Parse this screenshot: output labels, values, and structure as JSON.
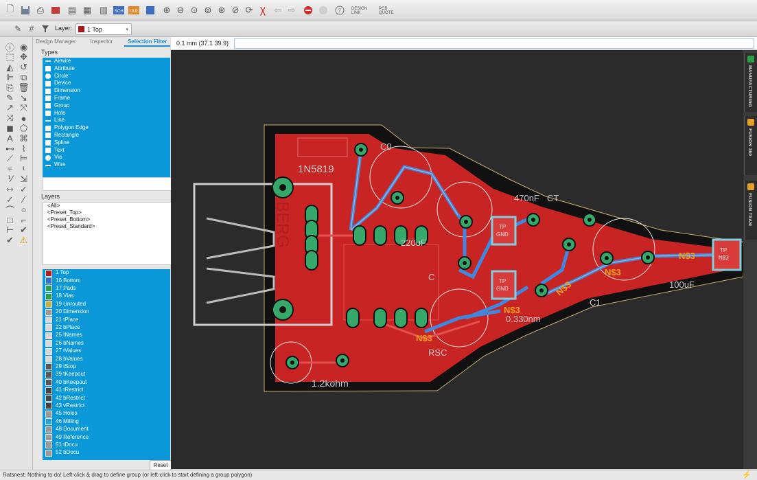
{
  "toolbar": {
    "icons": [
      "new-file-icon",
      "save-icon",
      "print-icon",
      "cam-icon",
      "script-icon",
      "run-icon",
      "board-icon",
      "sch-icon",
      "ulp-icon",
      "zoom-fit-icon",
      "zoom-in-icon",
      "zoom-out-icon",
      "zoom-select-icon",
      "zoom-area-icon",
      "redraw-icon",
      "undo-icon",
      "redo-icon",
      "stop-icon",
      "go-icon",
      "help-icon"
    ],
    "sch_label": "SCH",
    "ulp_label": "ULP",
    "design_link_label": "DESIGN LINK",
    "pcb_quote_label": "PCB QUOTE"
  },
  "layerbar": {
    "label": "Layer:",
    "selected": "1 Top",
    "selected_color": "#a31818"
  },
  "panel": {
    "tabs": [
      "Design Manager",
      "Inspector",
      "Selection Filter"
    ],
    "active_tab": "Selection Filter",
    "types_heading": "Types",
    "types": [
      {
        "label": "Airwire",
        "icon": "airwire-icon"
      },
      {
        "label": "Attribute",
        "icon": "attribute-icon"
      },
      {
        "label": "Circle",
        "icon": "circle-icon"
      },
      {
        "label": "Device",
        "icon": "device-icon"
      },
      {
        "label": "Dimension",
        "icon": "dimension-icon"
      },
      {
        "label": "Frame",
        "icon": "frame-icon"
      },
      {
        "label": "Group",
        "icon": "group-icon"
      },
      {
        "label": "Hole",
        "icon": "hole-icon"
      },
      {
        "label": "Line",
        "icon": "line-icon"
      },
      {
        "label": "Polygon Edge",
        "icon": "polygon-icon"
      },
      {
        "label": "Rectangle",
        "icon": "rectangle-icon"
      },
      {
        "label": "Spline",
        "icon": "spline-icon"
      },
      {
        "label": "Text",
        "icon": "text-icon"
      },
      {
        "label": "Via",
        "icon": "via-icon"
      },
      {
        "label": "Wire",
        "icon": "wire-icon"
      }
    ],
    "layers_heading": "Layers",
    "presets": [
      "<All>",
      "<Preset_Top>",
      "<Preset_Bottom>",
      "<Preset_Standard>"
    ],
    "layers": [
      {
        "label": "1 Top",
        "color": "#b31d1d"
      },
      {
        "label": "16 Bottom",
        "color": "#2a6fd6"
      },
      {
        "label": "17 Pads",
        "color": "#2e9e4a"
      },
      {
        "label": "18 Vias",
        "color": "#2e9e4a"
      },
      {
        "label": "19 Unrouted",
        "color": "#c9b23a"
      },
      {
        "label": "20 Dimension",
        "color": "#9a9a9a"
      },
      {
        "label": "21 tPlace",
        "color": "#d8d8d8"
      },
      {
        "label": "22 bPlace",
        "color": "#d8d8d8"
      },
      {
        "label": "25 tNames",
        "color": "#d8d8d8"
      },
      {
        "label": "26 bNames",
        "color": "#d8d8d8"
      },
      {
        "label": "27 tValues",
        "color": "#d8d8d8"
      },
      {
        "label": "28 bValues",
        "color": "#d8d8d8"
      },
      {
        "label": "29 tStop",
        "color": "#555555"
      },
      {
        "label": "39 tKeepout",
        "color": "#555555"
      },
      {
        "label": "40 bKeepout",
        "color": "#555555"
      },
      {
        "label": "41 tRestrict",
        "color": "#444444"
      },
      {
        "label": "42 bRestrict",
        "color": "#444444"
      },
      {
        "label": "43 vRestrict",
        "color": "#444444"
      },
      {
        "label": "45 Holes",
        "color": "#9a9a9a"
      },
      {
        "label": "46 Milling",
        "color": "#2aa0d8"
      },
      {
        "label": "48 Document",
        "color": "#9a9a9a"
      },
      {
        "label": "49 Reference",
        "color": "#9a9a9a"
      },
      {
        "label": "51 tDocu",
        "color": "#9a9a9a"
      },
      {
        "label": "52 bDocu",
        "color": "#9a9a9a"
      }
    ],
    "reset_label": "Reset"
  },
  "command": {
    "coords": "0.1 mm (37.1 39.9)",
    "value": ""
  },
  "right_tabs": [
    {
      "label": "MANUFACTURING",
      "badge_color": "#2e9e4a"
    },
    {
      "label": "FUSION 360",
      "badge_color": "#e8a020"
    },
    {
      "label": "FUSION TEAM",
      "badge_color": "#e8a020"
    }
  ],
  "board": {
    "texts": [
      "1N5819",
      "C0",
      "470nF",
      "CT",
      "220uF",
      "C",
      "TP",
      "GND",
      "N$3",
      "100uF",
      "C1",
      "0.330nm",
      "RSC",
      "1.2kohm",
      "BERG"
    ],
    "net_label": "N$3"
  },
  "status": {
    "text": "Ratsnest: Nothing to do! Left-click & drag to define group (or left-click to start defining a group polygon)"
  }
}
